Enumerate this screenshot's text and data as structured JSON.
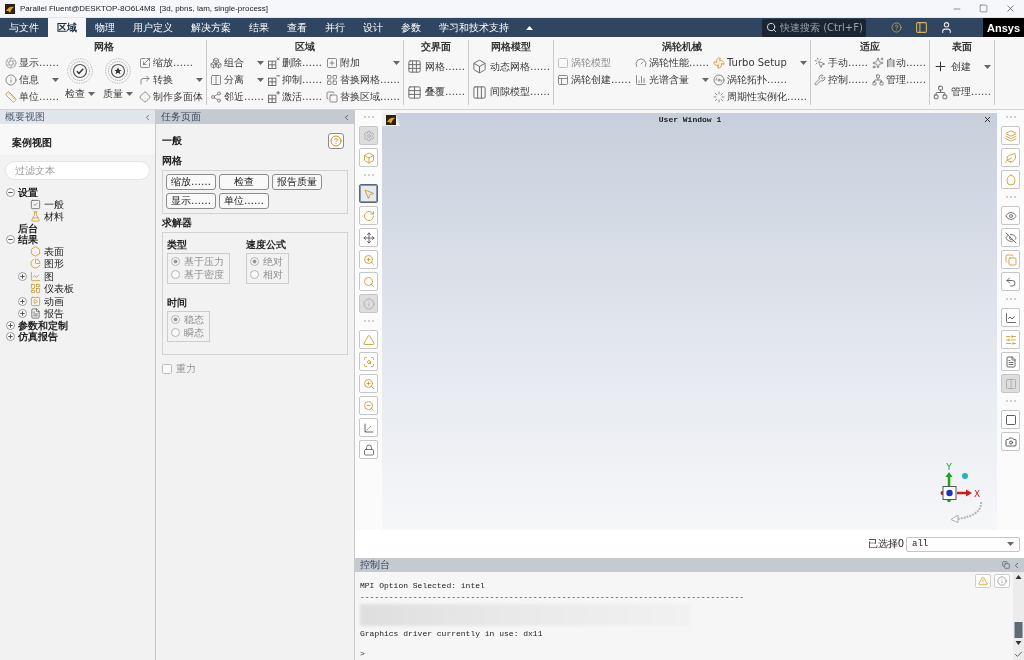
{
  "window": {
    "title": "Parallel Fluent@DESKTOP-8O6L4M8  [3d, pbns, lam, single-process]"
  },
  "menu_tabs": [
    {
      "label": "与文件",
      "selected": false
    },
    {
      "label": "区域",
      "selected": true
    },
    {
      "label": "物理",
      "selected": false
    },
    {
      "label": "用户定义",
      "selected": false
    },
    {
      "label": "解决方案",
      "selected": false
    },
    {
      "label": "结果",
      "selected": false
    },
    {
      "label": "查看",
      "selected": false
    },
    {
      "label": "并行",
      "selected": false
    },
    {
      "label": "设计",
      "selected": false
    },
    {
      "label": "参数",
      "selected": false
    },
    {
      "label": "学习和技术支持",
      "selected": false
    }
  ],
  "quick_search": {
    "placeholder": "快速搜索 (Ctrl+F)"
  },
  "brand": "Ansys",
  "ribbon": [
    {
      "title": "网格",
      "columns": [
        [
          {
            "kind": "small",
            "label": "显示……",
            "dropdown": false
          },
          {
            "kind": "small",
            "label": "信息",
            "dropdown": true
          },
          {
            "kind": "small",
            "label": "单位……",
            "dropdown": false
          }
        ],
        [
          {
            "kind": "large",
            "label": "检查",
            "dropdown": true
          }
        ],
        [
          {
            "kind": "large",
            "label": "质量",
            "dropdown": true
          }
        ],
        [
          {
            "kind": "small",
            "label": "缩放……",
            "dropdown": false
          },
          {
            "kind": "small",
            "label": "转换",
            "dropdown": true
          },
          {
            "kind": "small",
            "label": "制作多面体",
            "dropdown": false
          }
        ]
      ]
    },
    {
      "title": "区域",
      "columns": [
        [
          {
            "kind": "small",
            "label": "组合",
            "dropdown": true
          },
          {
            "kind": "small",
            "label": "分离",
            "dropdown": true
          },
          {
            "kind": "small",
            "label": "邻近……",
            "dropdown": false
          }
        ],
        [
          {
            "kind": "small",
            "label": "删除……",
            "dropdown": false
          },
          {
            "kind": "small",
            "label": "抑制……",
            "dropdown": false
          },
          {
            "kind": "small",
            "label": "激活……",
            "dropdown": false
          }
        ],
        [
          {
            "kind": "small",
            "label": "附加",
            "dropdown": true
          },
          {
            "kind": "small",
            "label": "替换网格……",
            "dropdown": false
          },
          {
            "kind": "small",
            "label": "替换区域……",
            "dropdown": false
          }
        ]
      ]
    },
    {
      "title": "交界面",
      "columns": [
        [
          {
            "kind": "medium",
            "label": "网格……",
            "dropdown": false
          },
          {
            "kind": "medium",
            "label": "叠覆……",
            "dropdown": false
          }
        ]
      ]
    },
    {
      "title": "网格模型",
      "columns": [
        [
          {
            "kind": "medium",
            "label": "动态网格……",
            "dropdown": false
          },
          {
            "kind": "medium",
            "label": "间隙模型……",
            "dropdown": false
          }
        ]
      ]
    },
    {
      "title": "涡轮机械",
      "columns": [
        [
          {
            "kind": "checkbox",
            "label": "涡轮模型",
            "checked": false
          },
          {
            "kind": "small",
            "label": "涡轮创建……",
            "dropdown": false
          }
        ],
        [
          {
            "kind": "small",
            "label": "涡轮性能……",
            "dropdown": false
          },
          {
            "kind": "small",
            "label": "光谱含量",
            "dropdown": true
          }
        ],
        [
          {
            "kind": "small",
            "label": "Turbo Setup",
            "dropdown": true
          },
          {
            "kind": "small",
            "label": "涡轮拓扑……",
            "dropdown": false
          },
          {
            "kind": "small",
            "label": "周期性实例化……",
            "dropdown": false
          }
        ]
      ]
    },
    {
      "title": "适应",
      "columns": [
        [
          {
            "kind": "small",
            "label": "手动……",
            "dropdown": false
          },
          {
            "kind": "small",
            "label": "控制……",
            "dropdown": false
          }
        ],
        [
          {
            "kind": "small",
            "label": "自动……",
            "dropdown": false
          },
          {
            "kind": "small",
            "label": "管理……",
            "dropdown": false
          }
        ]
      ]
    },
    {
      "title": "表面",
      "columns": [
        [
          {
            "kind": "medium",
            "label": "创建",
            "dropdown": true
          },
          {
            "kind": "medium",
            "label": "管理……",
            "dropdown": false
          }
        ]
      ]
    }
  ],
  "outline": {
    "title": "概要视图",
    "heading": "案例视图",
    "filter": {
      "placeholder": "过滤文本"
    },
    "tree": [
      {
        "label": "设置",
        "expanded": true,
        "children": [
          {
            "label": "一般"
          },
          {
            "label": "材料"
          }
        ]
      },
      {
        "label": "后台"
      },
      {
        "label": "结果",
        "expanded": true,
        "children": [
          {
            "label": "表面"
          },
          {
            "label": "图形"
          },
          {
            "label": "图",
            "expanded": false
          },
          {
            "label": "仪表板"
          },
          {
            "label": "动画",
            "expanded": false
          },
          {
            "label": "报告",
            "expanded": false
          }
        ]
      },
      {
        "label": "参数和定制",
        "expanded": false
      },
      {
        "label": "仿真报告",
        "expanded": false
      }
    ]
  },
  "task_page": {
    "title": "任务页面",
    "heading": "一般",
    "mesh": {
      "title": "网格",
      "buttons": [
        "缩放……",
        "检查",
        "报告质量",
        "显示……",
        "单位……"
      ]
    },
    "solver": {
      "title": "求解器",
      "groups": [
        {
          "title": "类型",
          "options": [
            {
              "label": "基于压力",
              "selected": true,
              "disabled": true
            },
            {
              "label": "基于密度",
              "selected": false,
              "disabled": true
            }
          ]
        },
        {
          "title": "速度公式",
          "options": [
            {
              "label": "绝对",
              "selected": true,
              "disabled": true
            },
            {
              "label": "相对",
              "selected": false,
              "disabled": true
            }
          ]
        },
        {
          "title": "时间",
          "options": [
            {
              "label": "稳态",
              "selected": true,
              "disabled": true
            },
            {
              "label": "瞬态",
              "selected": false,
              "disabled": true
            }
          ]
        }
      ]
    },
    "gravity": {
      "label": "重力",
      "checked": false,
      "disabled": true
    }
  },
  "graphics": {
    "title": "User Window 1",
    "left_toolbar": [
      [
        {
          "selected": false,
          "disabled": true
        },
        {
          "selected": false,
          "disabled": false
        }
      ],
      [
        {
          "selected": true,
          "disabled": false
        },
        {
          "selected": false,
          "disabled": false
        },
        {
          "selected": false,
          "disabled": false
        },
        {
          "selected": false,
          "disabled": false
        },
        {
          "selected": false,
          "disabled": false
        },
        {
          "selected": false,
          "disabled": true
        }
      ],
      [
        {
          "selected": false,
          "disabled": false
        },
        {
          "selected": false,
          "disabled": false
        },
        {
          "selected": false,
          "disabled": false
        },
        {
          "selected": false,
          "disabled": false
        },
        {
          "selected": false,
          "disabled": false
        },
        {
          "selected": false,
          "disabled": false
        }
      ]
    ],
    "right_toolbar": [
      [
        {
          "selected": false,
          "disabled": false
        },
        {
          "selected": false,
          "disabled": false
        },
        {
          "selected": false,
          "disabled": false
        }
      ],
      [
        {
          "selected": false,
          "disabled": false
        },
        {
          "selected": false,
          "disabled": false
        },
        {
          "selected": false,
          "disabled": false
        },
        {
          "selected": false,
          "disabled": false
        }
      ],
      [
        {
          "selected": false,
          "disabled": false
        },
        {
          "selected": false,
          "disabled": false
        },
        {
          "selected": false,
          "disabled": false
        },
        {
          "selected": false,
          "disabled": true
        }
      ],
      [
        {
          "selected": false,
          "disabled": false
        },
        {
          "selected": false,
          "disabled": false
        }
      ]
    ],
    "triad": {
      "x_label": "X",
      "y_label": "Y"
    }
  },
  "selection": {
    "label": "已选择0",
    "value": "all"
  },
  "console": {
    "title": "控制台",
    "lines": [
      {
        "kind": "text",
        "text": "MPI Option Selected: intel"
      },
      {
        "kind": "text",
        "text": "--------------------------------------------------------------------------------"
      },
      {
        "kind": "blurred"
      },
      {
        "kind": "text",
        "text": "Graphics driver currently in use: dx11"
      }
    ],
    "prompt": ">"
  }
}
